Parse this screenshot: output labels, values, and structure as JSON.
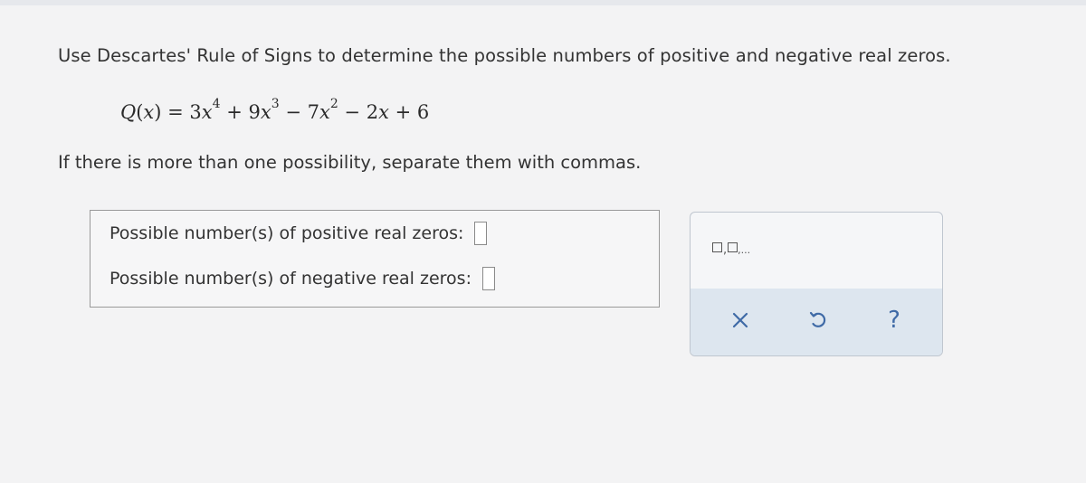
{
  "instruction": "Use Descartes' Rule of Signs to determine the possible numbers of positive and negative real zeros.",
  "equation": {
    "lhs_name": "Q",
    "lhs_var": "x",
    "equals": " = ",
    "t1_coef": "3",
    "t1_var": "x",
    "t1_exp": "4",
    "op1": " + ",
    "t2_coef": "9",
    "t2_var": "x",
    "t2_exp": "3",
    "op2": " − ",
    "t3_coef": "7",
    "t3_var": "x",
    "t3_exp": "2",
    "op3": " − ",
    "t4_coef": "2",
    "t4_var": "x",
    "op4": " + ",
    "constant": "6"
  },
  "note": "If there is more than one possibility, separate them with commas.",
  "answers": {
    "positive_label": "Possible number(s) of positive real zeros:",
    "positive_value": "",
    "negative_label": "Possible number(s) of negative real zeros:",
    "negative_value": ""
  },
  "tools": {
    "multi_entry_icon": "multiple-answer-template-icon",
    "clear_icon": "close-icon",
    "undo_icon": "undo-icon",
    "help_icon": "help-icon",
    "help_glyph": "?"
  },
  "colors": {
    "accent": "#3f6aa6",
    "tool_footer": "#dde6ef"
  }
}
